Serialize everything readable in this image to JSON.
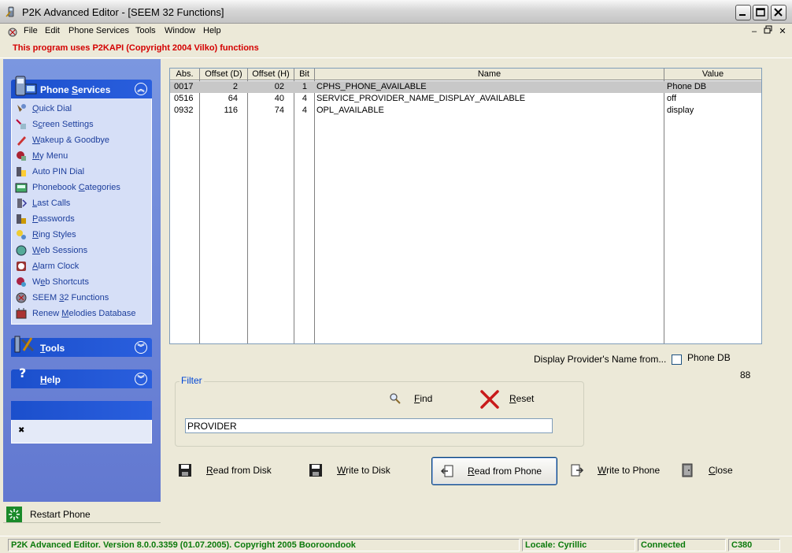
{
  "window": {
    "title": "P2K Advanced Editor - [SEEM 32 Functions]",
    "controls": [
      "minimize",
      "maximize",
      "close"
    ]
  },
  "menu": {
    "items": [
      "File",
      "Edit",
      "Phone Services",
      "Tools",
      "Window",
      "Help"
    ]
  },
  "notice": "This program uses P2KAPI (Copyright 2004 Vilko) functions",
  "sidebar": {
    "phone_services": {
      "title": "Phone Services",
      "items": [
        {
          "label": "Quick Dial",
          "icon": "quick-dial-icon"
        },
        {
          "label": "Screen Settings",
          "icon": "screen-settings-icon"
        },
        {
          "label": "Wakeup & Goodbye",
          "icon": "wakeup-icon"
        },
        {
          "label": "My Menu",
          "icon": "my-menu-icon"
        },
        {
          "label": "Auto PIN Dial",
          "icon": "auto-pin-icon"
        },
        {
          "label": "Phonebook Categories",
          "icon": "phonebook-icon"
        },
        {
          "label": "Last Calls",
          "icon": "last-calls-icon"
        },
        {
          "label": "Passwords",
          "icon": "passwords-icon"
        },
        {
          "label": "Ring Styles",
          "icon": "ring-styles-icon"
        },
        {
          "label": "Web Sessions",
          "icon": "web-sessions-icon"
        },
        {
          "label": "Alarm Clock",
          "icon": "alarm-clock-icon"
        },
        {
          "label": "Web Shortcuts",
          "icon": "web-shortcuts-icon"
        },
        {
          "label": "SEEM 32 Functions",
          "icon": "seem-icon"
        },
        {
          "label": "Renew Melodies Database",
          "icon": "renew-melodies-icon"
        }
      ]
    },
    "tools": {
      "title": "Tools"
    },
    "help": {
      "title": "Help"
    },
    "restart": "Restart Phone"
  },
  "table": {
    "columns": [
      "Abs.",
      "Offset (D)",
      "Offset (H)",
      "Bit",
      "Name",
      "Value"
    ],
    "rows": [
      {
        "abs": "0017",
        "offd": "2",
        "offh": "02",
        "bit": "1",
        "name": "CPHS_PHONE_AVAILABLE",
        "value": "Phone DB",
        "selected": true
      },
      {
        "abs": "0516",
        "offd": "64",
        "offh": "40",
        "bit": "4",
        "name": "SERVICE_PROVIDER_NAME_DISPLAY_AVAILABLE",
        "value": "off",
        "selected": false
      },
      {
        "abs": "0932",
        "offd": "116",
        "offh": "74",
        "bit": "4",
        "name": "OPL_AVAILABLE",
        "value": "display",
        "selected": false
      }
    ]
  },
  "provider": {
    "label": "Display Provider's Name from...",
    "checkbox_label": "Phone DB",
    "checked": false,
    "count": "88"
  },
  "filter": {
    "legend": "Filter",
    "find": "Find",
    "reset": "Reset",
    "value": "PROVIDER"
  },
  "actions": {
    "read_disk": "Read from Disk",
    "write_disk": "Write to Disk",
    "read_phone": "Read from Phone",
    "write_phone": "Write to Phone",
    "close": "Close"
  },
  "status": {
    "version": "P2K Advanced Editor. Version 8.0.0.3359 (01.07.2005). Copyright 2005 Booroondook",
    "locale": "Locale: Cyrillic",
    "connection": "Connected",
    "model": "C380"
  }
}
